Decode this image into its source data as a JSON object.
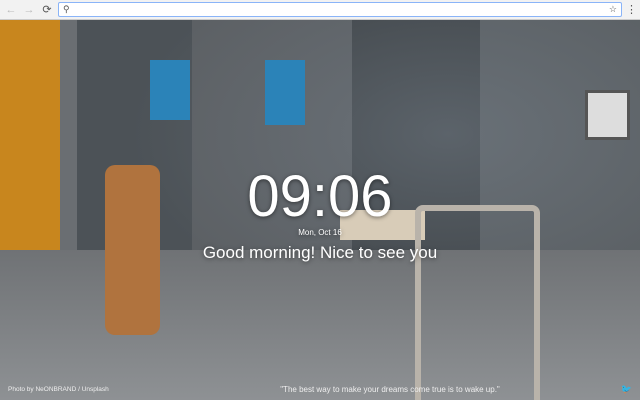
{
  "browser": {
    "omnibox_value": "",
    "icons": [
      "back-icon",
      "forward-icon",
      "reload-icon",
      "search-icon",
      "star-icon",
      "menu-icon"
    ]
  },
  "dashboard": {
    "time": "09:06",
    "date": "Mon, Oct 16",
    "greeting": "Good morning! Nice to see you"
  },
  "footer": {
    "photo_credit": "Photo by NeONBRAND / Unsplash",
    "quote": "\"The best way to make your dreams come true is to wake up.\"",
    "twitter_icon": "twitter-icon"
  }
}
